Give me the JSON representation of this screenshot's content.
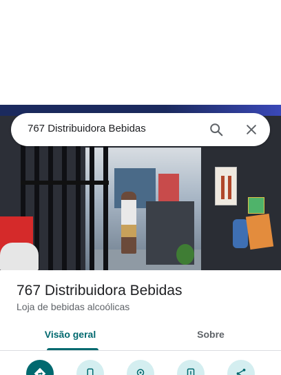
{
  "search": {
    "query": "767 Distribuidora Bebidas",
    "search_icon": "search-icon",
    "close_icon": "close-icon"
  },
  "place": {
    "name": "767 Distribuidora Bebidas",
    "category": "Loja de bebidas alcoólicas"
  },
  "tabs": [
    {
      "label": "Visão geral",
      "active": true
    },
    {
      "label": "Sobre",
      "active": false
    }
  ],
  "actions": [
    {
      "icon": "directions-icon"
    },
    {
      "icon": "phone-icon"
    },
    {
      "icon": "nearby-icon"
    },
    {
      "icon": "send-to-phone-icon"
    },
    {
      "icon": "share-icon"
    }
  ],
  "colors": {
    "accent": "#01696f",
    "accent_light": "#d4eef0",
    "text_primary": "#202124",
    "text_secondary": "#5f6368"
  }
}
